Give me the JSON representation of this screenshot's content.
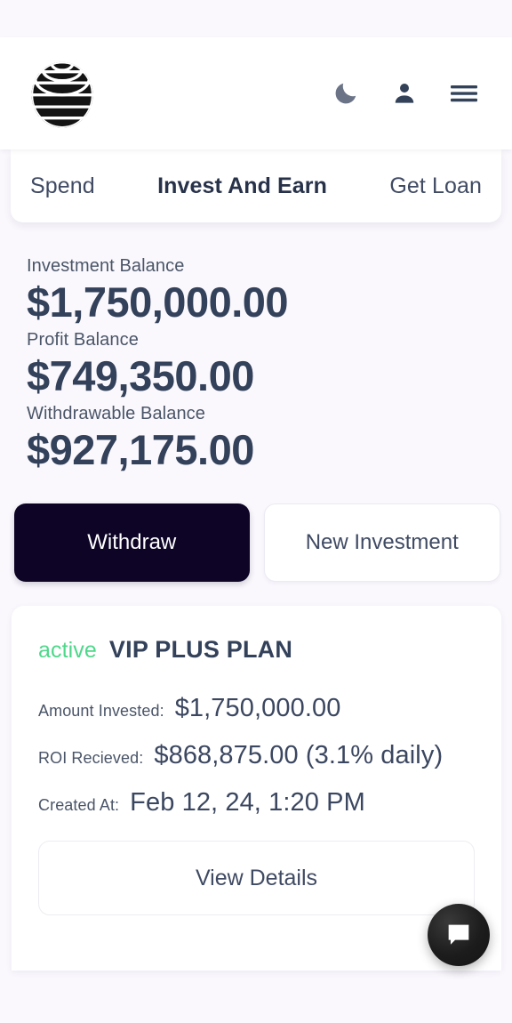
{
  "theme": {
    "page_bg": "#faf8fd",
    "surface": "#ffffff",
    "text_primary": "#33415a",
    "text_secondary": "#4a5568",
    "primary_button_bg": "#0d0426",
    "status_active_color": "#4ed88a",
    "fab_bg": "#1c1c1c"
  },
  "header": {
    "logo_name": "striped-globe-logo",
    "icons": [
      {
        "name": "dark-mode-moon-icon",
        "label": "Toggle dark mode"
      },
      {
        "name": "user-account-icon",
        "label": "Account"
      },
      {
        "name": "hamburger-menu-icon",
        "label": "Menu"
      }
    ]
  },
  "tabs": [
    {
      "id": "spend",
      "label": "Spend",
      "active": false
    },
    {
      "id": "invest-and-earn",
      "label": "Invest And Earn",
      "active": true
    },
    {
      "id": "get-loan",
      "label": "Get Loan",
      "active": false
    }
  ],
  "balances": [
    {
      "id": "investment",
      "label": "Investment Balance",
      "value": "$1,750,000.00"
    },
    {
      "id": "profit",
      "label": "Profit Balance",
      "value": "$749,350.00"
    },
    {
      "id": "withdrawable",
      "label": "Withdrawable Balance",
      "value": "$927,175.00"
    }
  ],
  "actions": {
    "withdraw_label": "Withdraw",
    "new_investment_label": "New Investment"
  },
  "plan": {
    "status": "active",
    "name": "VIP PLUS PLAN",
    "rows": [
      {
        "id": "amount-invested",
        "label": "Amount Invested:",
        "value": "$1,750,000.00"
      },
      {
        "id": "roi-recieved",
        "label": "ROI Recieved:",
        "value": "$868,875.00  (3.1% daily)"
      },
      {
        "id": "created-at",
        "label": "Created At:",
        "value": "Feb 12, 24, 1:20 PM"
      }
    ],
    "view_details_label": "View Details"
  },
  "fab": {
    "name": "chat-bubble-icon",
    "label": "Open chat"
  }
}
